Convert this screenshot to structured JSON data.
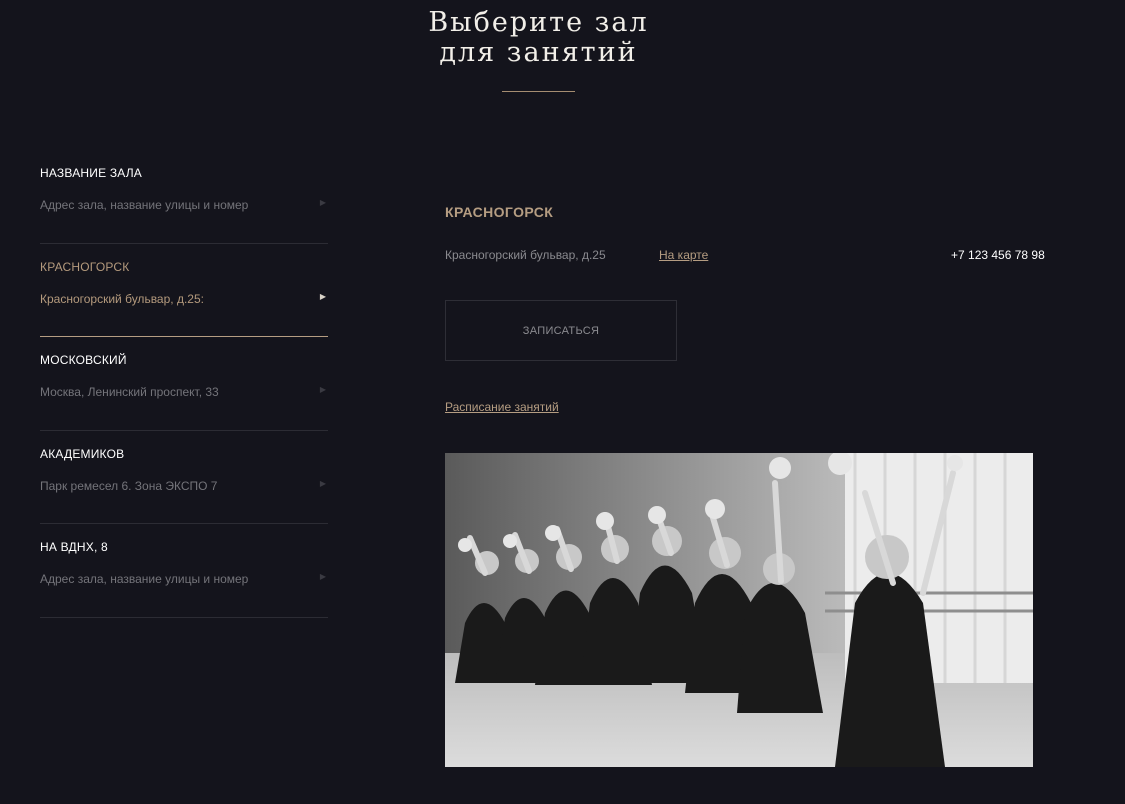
{
  "header": {
    "title_line1": "Выберите зал",
    "title_line2": "для занятий"
  },
  "sidebar": {
    "halls": [
      {
        "name": "НАЗВАНИЕ ЗАЛА",
        "address": "Адрес зала, название улицы и номер",
        "active": false
      },
      {
        "name": "КРАСНОГОРСК",
        "address": "Красногорский бульвар, д.25:",
        "active": true
      },
      {
        "name": "МОСКОВСКИЙ",
        "address": "Москва, Ленинский проспект, 33",
        "active": false
      },
      {
        "name": "АКАДЕМИКОВ",
        "address": "Парк ремесел 6. Зона ЭКСПО 7",
        "active": false
      },
      {
        "name": "НА ВДНХ, 8",
        "address": "Адрес зала, название улицы и номер",
        "active": false
      }
    ],
    "arrow_icon": "triangle-right-icon"
  },
  "detail": {
    "city": "КРАСНОГОРСК",
    "address": "Красногорский бульвар, д.25",
    "map_link": "На карте",
    "phone": "+7 123 456 78 98",
    "signup_button": "ЗАПИСАТЬСЯ",
    "schedule_link": "Расписание занятий"
  },
  "colors": {
    "background": "#14141c",
    "accent": "#b59d82"
  }
}
